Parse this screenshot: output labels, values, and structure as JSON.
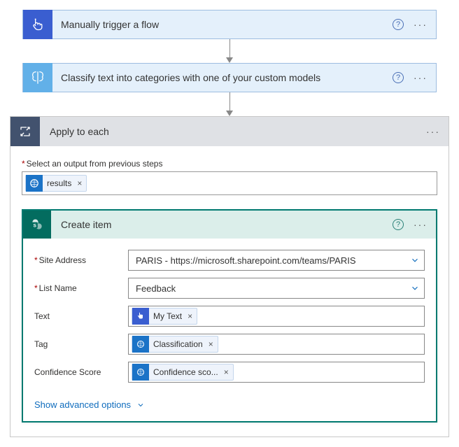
{
  "card1": {
    "title": "Manually trigger a flow"
  },
  "card2": {
    "title": "Classify text into categories with one of your custom models"
  },
  "applyEach": {
    "title": "Apply to each",
    "outputLabel": "Select an output from previous steps",
    "outputToken": "results"
  },
  "createItem": {
    "title": "Create item",
    "labels": {
      "site": "Site Address",
      "list": "List Name",
      "text": "Text",
      "tag": "Tag",
      "conf": "Confidence Score"
    },
    "values": {
      "site": "PARIS - https://microsoft.sharepoint.com/teams/PARIS",
      "list": "Feedback"
    },
    "tokens": {
      "text": "My Text",
      "tag": "Classification",
      "conf": "Confidence sco..."
    },
    "advanced": "Show advanced options"
  }
}
